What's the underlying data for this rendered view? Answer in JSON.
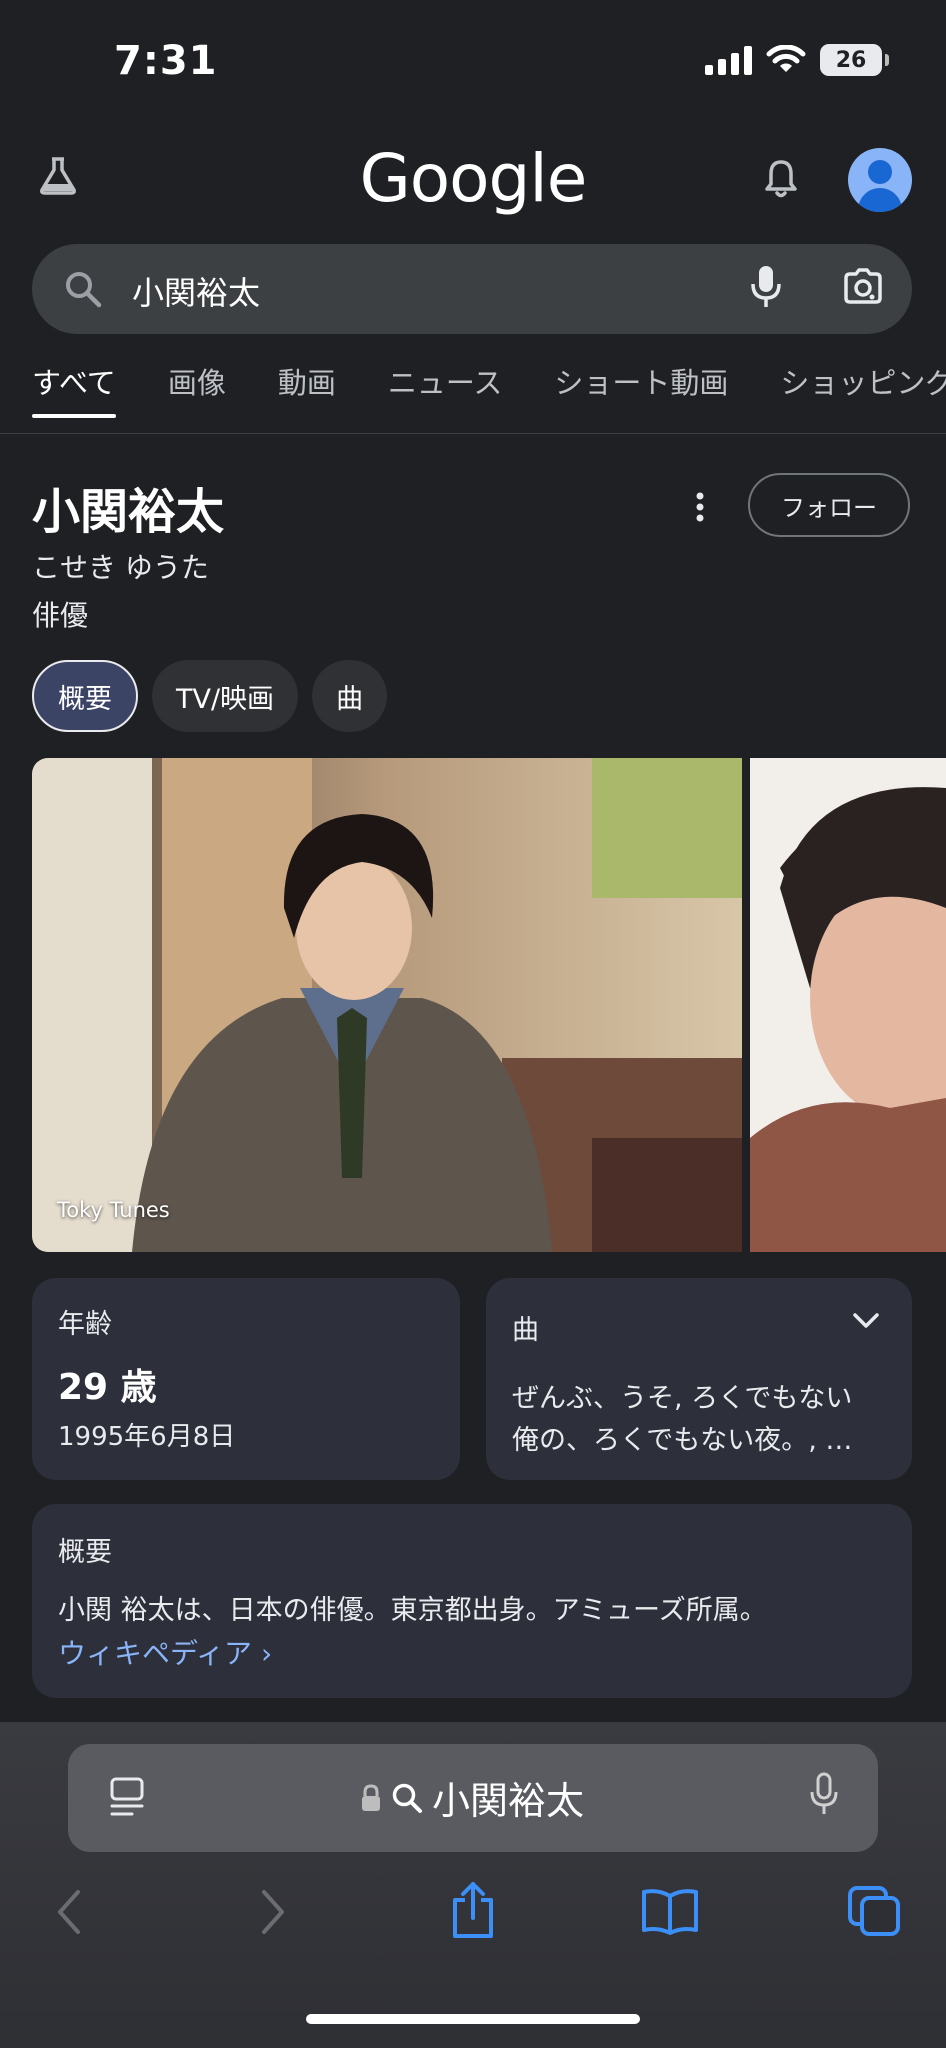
{
  "status_bar": {
    "time": "7:31",
    "battery": "26"
  },
  "header": {
    "logo": "Google",
    "icons": [
      "labs-flask-icon",
      "notifications-bell-icon",
      "account-avatar-icon"
    ]
  },
  "search": {
    "query": "小関裕太"
  },
  "tabs": [
    "すべて",
    "画像",
    "動画",
    "ニュース",
    "ショート動画",
    "ショッピング"
  ],
  "knowledge_panel": {
    "title": "小関裕太",
    "reading": "こせき ゆうた",
    "description": "俳優",
    "follow_label": "フォロー",
    "chips": [
      "概要",
      "TV/映画",
      "曲"
    ],
    "photo_caption": "Toky Tunes",
    "age_card": {
      "label": "年齢",
      "value": "29 歳",
      "birth_date": "1995年6月8日"
    },
    "songs_card": {
      "label": "曲",
      "line1": "ぜんぶ、うそ, ろくでもない",
      "line2": "俺の、ろくでもない夜。, …"
    },
    "overview_card": {
      "label": "概要",
      "text": "小関 裕太は、日本の俳優。東京都出身。アミューズ所属。",
      "link": "ウィキペディア ›"
    }
  },
  "safari": {
    "address": "小関裕太"
  },
  "colors": {
    "background": "#1f2023",
    "card": "#2d2f3a",
    "link": "#8ab4f8",
    "safari_accent": "#3b8ff6"
  }
}
